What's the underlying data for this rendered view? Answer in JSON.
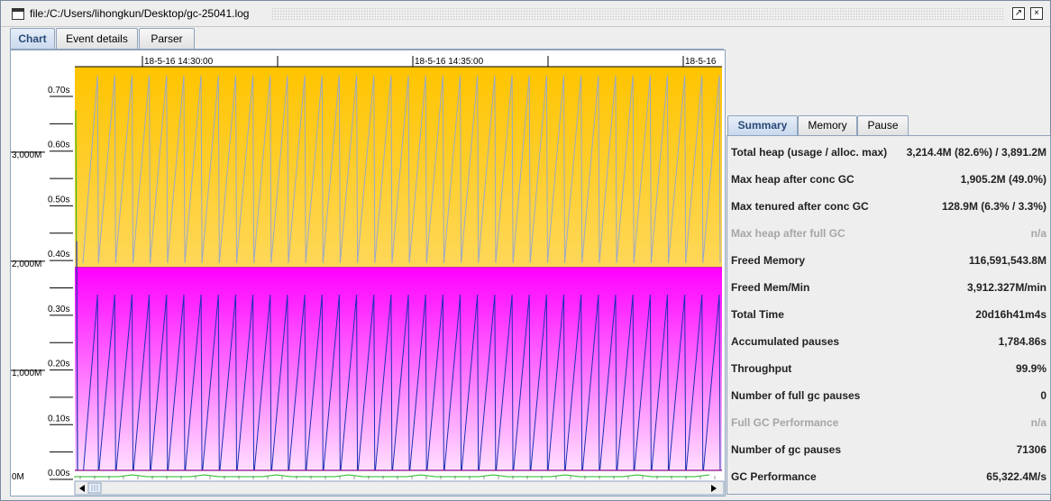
{
  "window": {
    "title": "file:/C:/Users/lihongkun/Desktop/gc-25041.log"
  },
  "main_tabs": [
    "Chart",
    "Event details",
    "Parser"
  ],
  "active_main_tab": "Chart",
  "right_tabs": [
    "Summary",
    "Memory",
    "Pause"
  ],
  "active_right_tab": "Summary",
  "summary": [
    {
      "label": "Total heap (usage / alloc. max)",
      "value": "3,214.4M (82.6%) / 3,891.2M",
      "enabled": true
    },
    {
      "label": "Max heap after conc GC",
      "value": "1,905.2M (49.0%)",
      "enabled": true
    },
    {
      "label": "Max tenured after conc GC",
      "value": "128.9M (6.3% / 3.3%)",
      "enabled": true
    },
    {
      "label": "Max heap after full GC",
      "value": "n/a",
      "enabled": false
    },
    {
      "label": "Freed Memory",
      "value": "116,591,543.8M",
      "enabled": true
    },
    {
      "label": "Freed Mem/Min",
      "value": "3,912.327M/min",
      "enabled": true
    },
    {
      "label": "Total Time",
      "value": "20d16h41m4s",
      "enabled": true
    },
    {
      "label": "Accumulated pauses",
      "value": "1,784.86s",
      "enabled": true
    },
    {
      "label": "Throughput",
      "value": "99.9%",
      "enabled": true
    },
    {
      "label": "Number of full gc pauses",
      "value": "0",
      "enabled": true
    },
    {
      "label": "Full GC Performance",
      "value": "n/a",
      "enabled": false
    },
    {
      "label": "Number of gc pauses",
      "value": "71306",
      "enabled": true
    },
    {
      "label": "GC Performance",
      "value": "65,322.4M/s",
      "enabled": true
    }
  ],
  "chart_data": {
    "type": "area",
    "x_tick_labels": [
      "18-5-16 14:30:00",
      "18-5-16 14:35:00",
      "18-5-16"
    ],
    "memory_axis_labels": [
      "3,000M",
      "2,000M",
      "1,000M",
      "0M"
    ],
    "memory_axis_values": [
      3000,
      2000,
      1000,
      0
    ],
    "pause_axis_labels": [
      "0.70s",
      "0.60s",
      "0.50s",
      "0.40s",
      "0.30s",
      "0.20s",
      "0.10s",
      "0.00s"
    ],
    "pause_axis_values": [
      0.7,
      0.6,
      0.5,
      0.4,
      0.3,
      0.2,
      0.1,
      0.0
    ],
    "memory_ylim": [
      0,
      3800
    ],
    "series": [
      {
        "name": "",
        "kind": "total heap (area)",
        "value": 3800,
        "color": "#ffc400"
      },
      {
        "name": "",
        "kind": "tenured generation (area)",
        "value": 1960,
        "color": "#ff00ff"
      },
      {
        "name": "",
        "kind": "young gen usage (sawtooth)",
        "low": 40,
        "high": 1710,
        "cycles": 37,
        "color": "#1c2fb5"
      },
      {
        "name": "",
        "kind": "tenured usage (sawtooth)",
        "low": 2000,
        "high": 3720,
        "cycles": 37,
        "color": "#9aa8c8"
      }
    ],
    "colors": {
      "heap_area": "#ffc400",
      "tenured_area": "#ff00ff",
      "young_line": "#1c2fb5",
      "tenured_line": "#9aa8c8",
      "pause_line": "#22b822",
      "used_heap_line": "#8b0a8b"
    }
  }
}
